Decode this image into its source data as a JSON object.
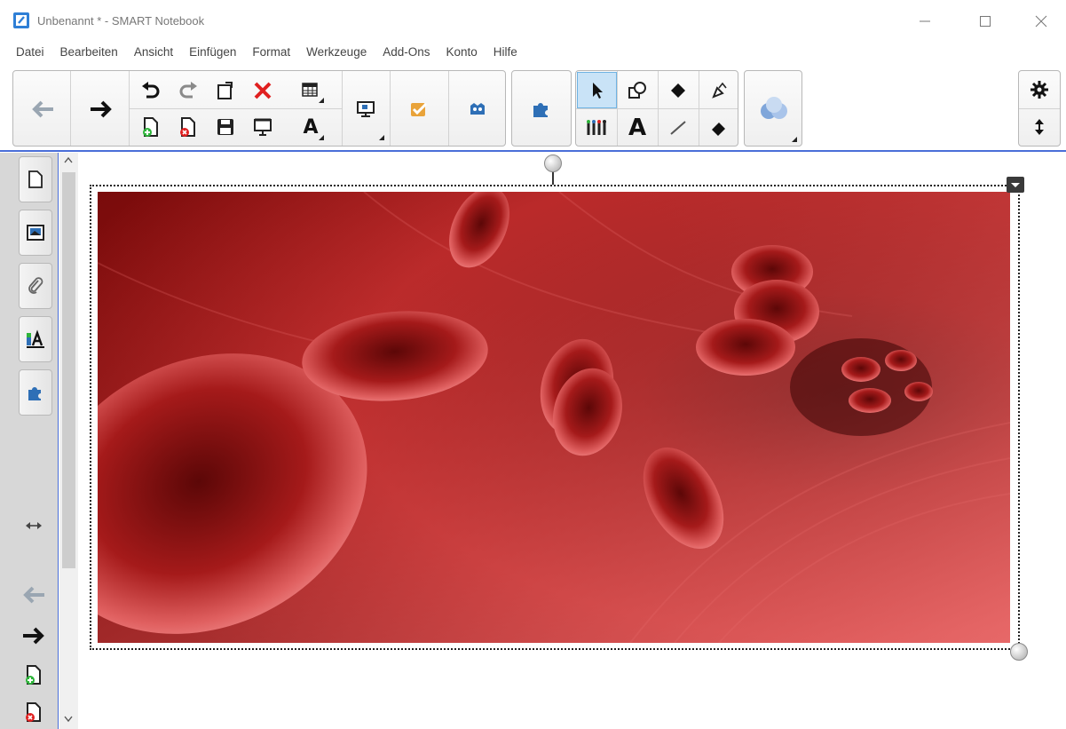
{
  "window": {
    "title": "Unbenannt * - SMART Notebook",
    "minimize_glyph": "—",
    "maximize_glyph": "☐",
    "close_glyph": "✕"
  },
  "menu": {
    "items": [
      "Datei",
      "Bearbeiten",
      "Ansicht",
      "Einfügen",
      "Format",
      "Werkzeuge",
      "Add-Ons",
      "Konto",
      "Hilfe"
    ]
  },
  "toolbar": {
    "text_tool_glyph": "A",
    "table_text_glyph": "A",
    "colors": {
      "accent_blue": "#2e6fb6",
      "back_arrow": "#9aa6b2",
      "forward_arrow": "#111111",
      "delete_red": "#e02020",
      "add_green": "#2db43a",
      "doc_yellow": "#e9a33a"
    },
    "icons": [
      "back-arrow-icon",
      "forward-arrow-icon",
      "undo-icon",
      "redo-icon",
      "paste-icon",
      "delete-icon",
      "table-icon",
      "new-page-icon",
      "delete-page-icon",
      "save-icon",
      "screen-shade-icon",
      "text-table-icon",
      "display-icon",
      "response-icon",
      "lab-icon",
      "add-ons-icon",
      "select-icon",
      "shapes-icon",
      "fill-icon",
      "magic-pen-icon",
      "creative-pen-icon",
      "text-icon",
      "line-icon",
      "eraser-icon",
      "properties-3d-icon",
      "settings-icon",
      "toolbar-position-icon"
    ]
  },
  "sidepanel": {
    "tabs": [
      "page-sorter-icon",
      "gallery-icon",
      "attachments-icon",
      "properties-icon",
      "add-ons-icon"
    ],
    "controls": [
      "swap-side-icon",
      "previous-page-icon",
      "next-page-icon",
      "add-page-icon",
      "delete-page-icon"
    ]
  },
  "canvas": {
    "image_subject": "red-blood-cells"
  }
}
